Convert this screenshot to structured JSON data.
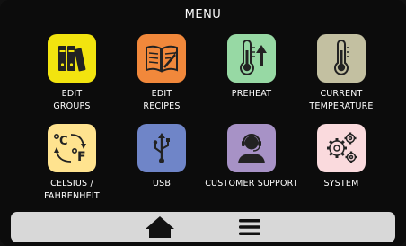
{
  "header": {
    "title": "MENU"
  },
  "tiles": [
    {
      "label": "EDIT\nGROUPS",
      "icon": "binders-icon",
      "color": "#f2e40f"
    },
    {
      "label": "EDIT\nRECIPES",
      "icon": "recipe-book-icon",
      "color": "#f1883b"
    },
    {
      "label": "PREHEAT",
      "icon": "thermometer-up-icon",
      "color": "#97d9a4"
    },
    {
      "label": "CURRENT\nTEMPERATURE",
      "icon": "thermometer-icon",
      "color": "#c3c0a1"
    },
    {
      "label": "CELSIUS /\nFAHRENHEIT",
      "icon": "celsius-fahrenheit-icon",
      "color": "#ffe38f"
    },
    {
      "label": "USB",
      "icon": "usb-icon",
      "color": "#6f85c8"
    },
    {
      "label": "CUSTOMER SUPPORT",
      "icon": "headset-agent-icon",
      "color": "#a792c6"
    },
    {
      "label": "SYSTEM",
      "icon": "gears-icon",
      "color": "#fadadd"
    }
  ],
  "bottom_bar": {
    "color": "#d8d8d8",
    "buttons": [
      {
        "icon": "home-icon"
      },
      {
        "icon": "hamburger-menu-icon"
      }
    ]
  }
}
